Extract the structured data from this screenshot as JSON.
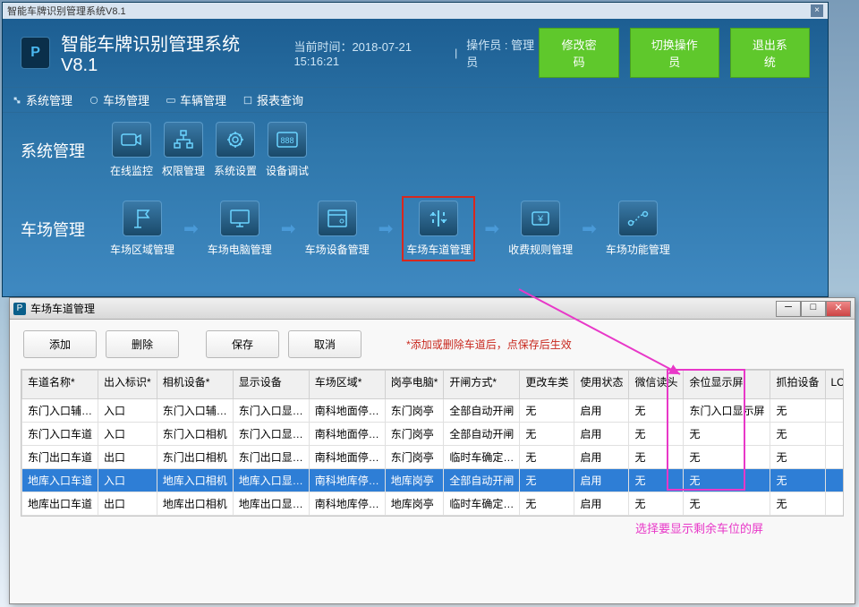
{
  "main": {
    "titlebar": "智能车牌识别管理系统V8.1",
    "app_title": "智能车牌识别管理系统V8.1",
    "timestamp": "当前时间：2018-07-21 15:16:21",
    "operator": "操作员 : 管理员",
    "buttons": {
      "pwd": "修改密码",
      "switch": "切换操作员",
      "exit": "退出系统"
    }
  },
  "menubar": {
    "sys": "系统管理",
    "park": "车场管理",
    "vehicle": "车辆管理",
    "report": "报表查询"
  },
  "section1": {
    "title": "系统管理",
    "items": [
      "在线监控",
      "权限管理",
      "系统设置",
      "设备调试"
    ]
  },
  "section2": {
    "title": "车场管理",
    "items": [
      "车场区域管理",
      "车场电脑管理",
      "车场设备管理",
      "车场车道管理",
      "收费规则管理",
      "车场功能管理"
    ]
  },
  "dialog": {
    "title": "车场车道管理",
    "toolbar": {
      "add": "添加",
      "del": "删除",
      "save": "保存",
      "cancel": "取消"
    },
    "hint": "*添加或删除车道后，点保存后生效",
    "columns": [
      "车道名称*",
      "出入标识*",
      "相机设备*",
      "显示设备",
      "车场区域*",
      "岗亭电脑*",
      "开闸方式*",
      "更改车类",
      "使用状态",
      "微信读头",
      "余位显示屏",
      "抓拍设备",
      "LCD屏IP"
    ],
    "rows": [
      {
        "selected": false,
        "cells": [
          "东门入口辅…",
          "入口",
          "东门入口辅…",
          "东门入口显…",
          "南科地面停…",
          "东门岗亭",
          "全部自动开闸",
          "无",
          "启用",
          "无",
          "东门入口显示屏",
          "无",
          ""
        ]
      },
      {
        "selected": false,
        "cells": [
          "东门入口车道",
          "入口",
          "东门入口相机",
          "东门入口显…",
          "南科地面停…",
          "东门岗亭",
          "全部自动开闸",
          "无",
          "启用",
          "无",
          "无",
          "无",
          ""
        ]
      },
      {
        "selected": false,
        "cells": [
          "东门出口车道",
          "出口",
          "东门出口相机",
          "东门出口显…",
          "南科地面停…",
          "东门岗亭",
          "临时车确定…",
          "无",
          "启用",
          "无",
          "无",
          "无",
          ""
        ]
      },
      {
        "selected": true,
        "cells": [
          "地库入口车道",
          "入口",
          "地库入口相机",
          "地库入口显…",
          "南科地库停…",
          "地库岗亭",
          "全部自动开闸",
          "无",
          "启用",
          "无",
          "无",
          "无",
          ""
        ]
      },
      {
        "selected": false,
        "cells": [
          "地库出口车道",
          "出口",
          "地库出口相机",
          "地库出口显…",
          "南科地库停…",
          "地库岗亭",
          "临时车确定…",
          "无",
          "启用",
          "无",
          "无",
          "无",
          ""
        ]
      }
    ]
  },
  "annotation": "选择要显示剩余车位的屏"
}
